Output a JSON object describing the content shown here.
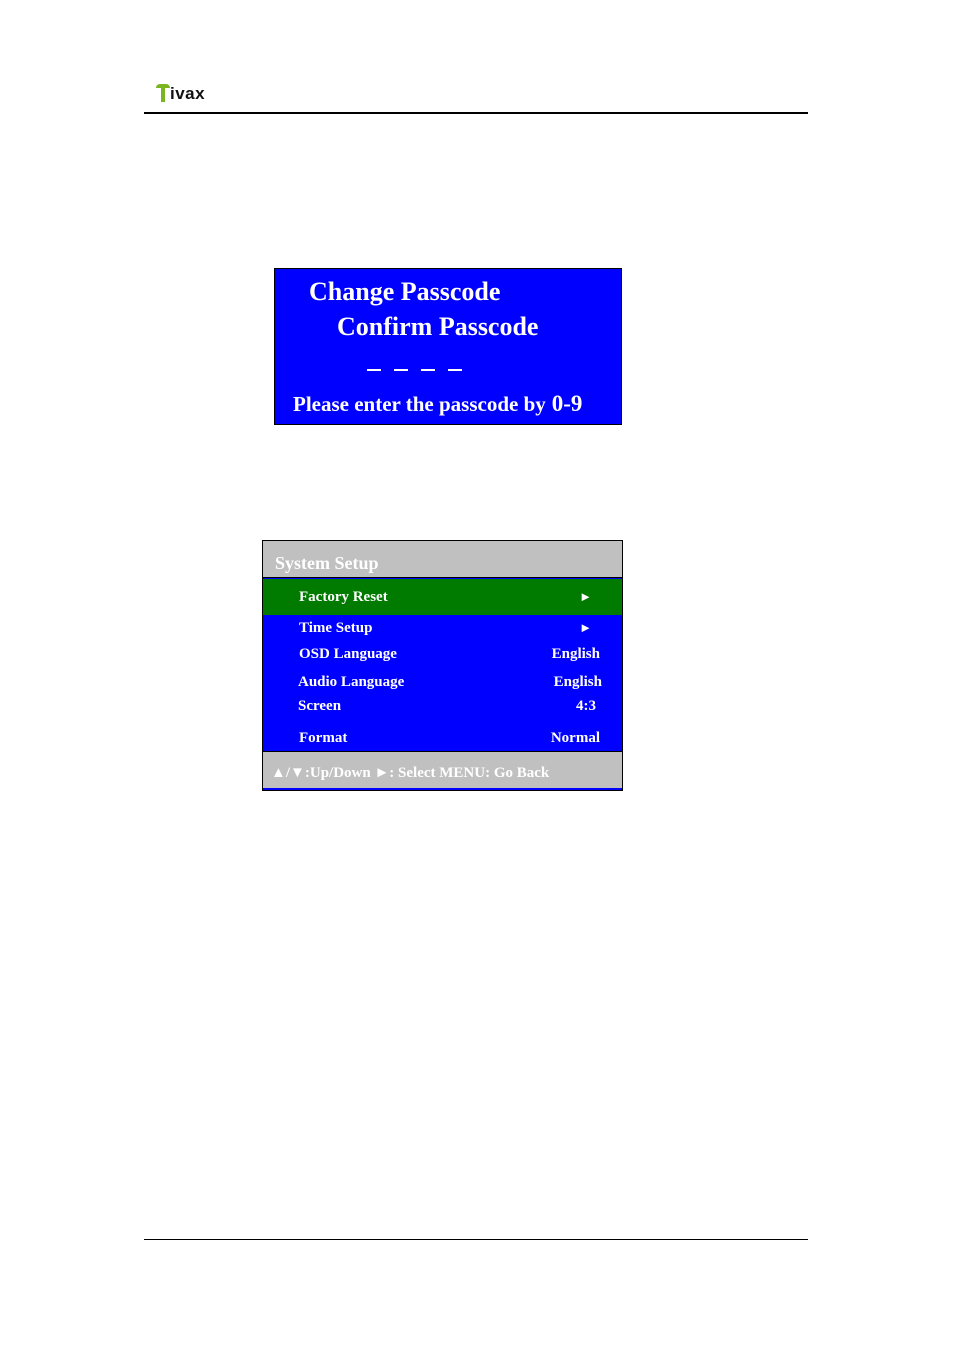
{
  "header": {
    "logo_text": "ivax",
    "logo_color": "#7ab51d"
  },
  "passcode_screen": {
    "title": "Change Passcode",
    "subtitle": "Confirm Passcode",
    "digit_slots": 4,
    "hint": "Please enter the passcode by",
    "range": "0-9",
    "background_color": "#0000ff"
  },
  "system_setup": {
    "title": "System Setup",
    "items": [
      {
        "label": "Factory Reset",
        "value": "",
        "has_arrow": true,
        "selected": true,
        "arrow_glyph": "►"
      },
      {
        "label": "Time Setup",
        "value": "",
        "has_arrow": true,
        "selected": false,
        "arrow_glyph": "►"
      },
      {
        "label": "OSD Language",
        "value": "English",
        "has_arrow": false,
        "selected": false
      },
      {
        "label": "Audio Language",
        "value": "English",
        "has_arrow": false,
        "selected": false
      },
      {
        "label": "Screen",
        "value": "4:3",
        "has_arrow": false,
        "selected": false
      },
      {
        "label": "Format",
        "value": "Normal",
        "has_arrow": false,
        "selected": false
      }
    ],
    "footer": "▲/▼:Up/Down ►: Select MENU: Go Back",
    "selected_color": "#007b00",
    "background_color": "#0000ff",
    "header_color": "#c0c0c0"
  }
}
